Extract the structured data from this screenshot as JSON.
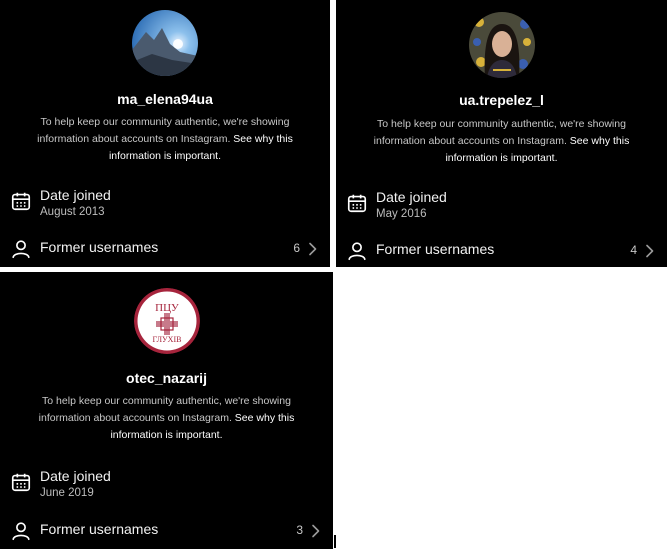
{
  "panels": [
    {
      "username": "ma_elena94ua",
      "info_text": "To help keep our community authentic, we're showing information about accounts on Instagram.",
      "info_link": "See why this information is important.",
      "date_joined_title": "Date joined",
      "date_joined_value": "August 2013",
      "former_usernames_label": "Former usernames",
      "former_usernames_count": "6"
    },
    {
      "username": "ua.trepelez_l",
      "info_text": "To help keep our community authentic, we're showing information about accounts on Instagram.",
      "info_link": "See why this information is important.",
      "date_joined_title": "Date joined",
      "date_joined_value": "May 2016",
      "former_usernames_label": "Former usernames",
      "former_usernames_count": "4"
    },
    {
      "username": "otec_nazarij",
      "info_text": "To help keep our community authentic, we're showing information about accounts on Instagram.",
      "info_link": "See why this information is important.",
      "date_joined_title": "Date joined",
      "date_joined_value": "June 2019",
      "former_usernames_label": "Former usernames",
      "former_usernames_count": "3",
      "logo_text_top": "ПЦУ",
      "logo_text_bottom": "ГЛУХІВ"
    }
  ],
  "icons": {
    "calendar": "calendar-icon",
    "person": "person-icon",
    "chevron": "chevron-right-icon"
  },
  "colors": {
    "panel_bg": "#000000",
    "text_primary": "#ffffff",
    "text_secondary": "#c8c8c8",
    "logo_red": "#a6243c"
  }
}
